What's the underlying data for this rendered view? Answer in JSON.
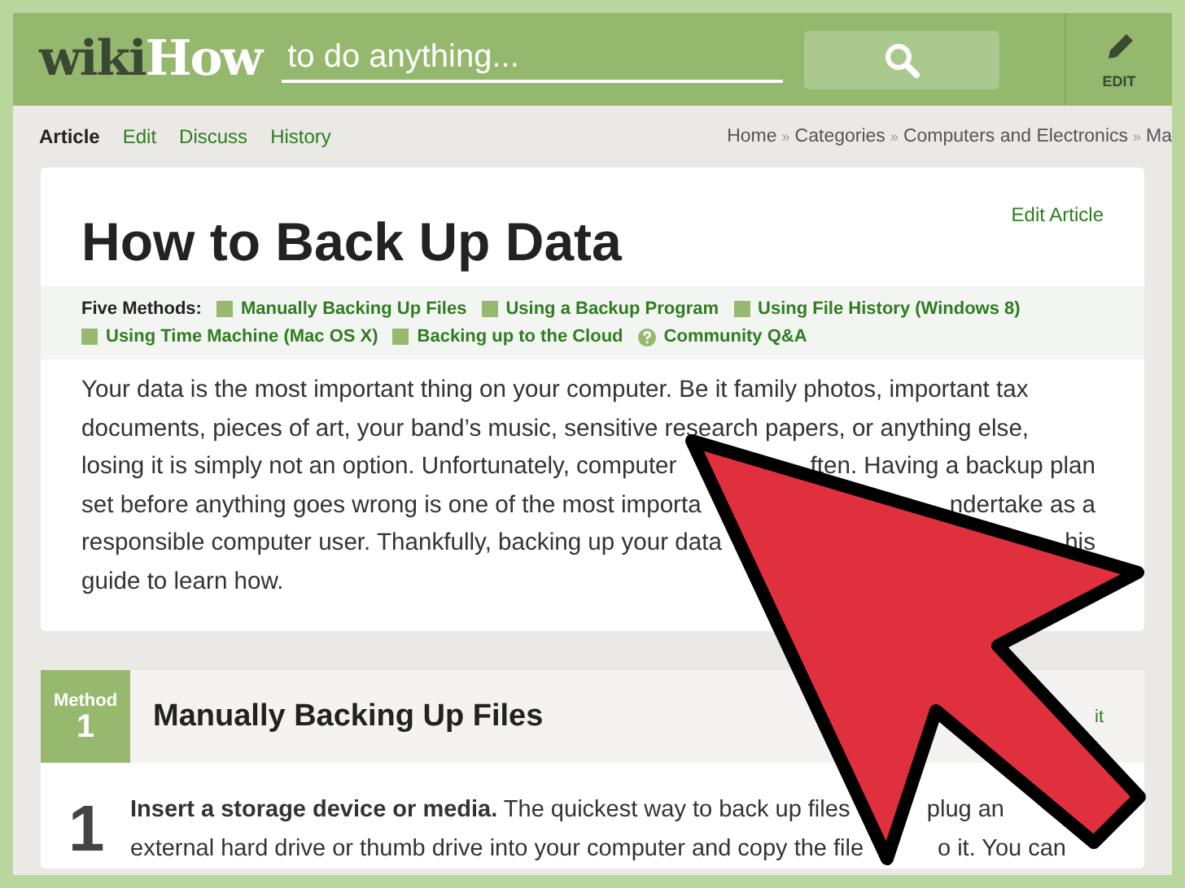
{
  "header": {
    "logo": {
      "part_1": "wiki",
      "part_2": "How"
    },
    "search": {
      "placeholder": "to do anything..."
    },
    "edit_button": "EDIT"
  },
  "tabs": [
    {
      "label": "Article",
      "selected": true
    },
    {
      "label": "Edit",
      "selected": false
    },
    {
      "label": "Discuss",
      "selected": false
    },
    {
      "label": "History",
      "selected": false
    }
  ],
  "breadcrumb": [
    "Home",
    "»",
    "Categories",
    "»",
    "Computers and Electronics",
    "»",
    "Ma"
  ],
  "article": {
    "title": "How to Back Up Data",
    "edit_link": "Edit Article",
    "methods_label": "Five Methods:",
    "methods": [
      {
        "kind": "method",
        "label": "Manually Backing Up Files"
      },
      {
        "kind": "method",
        "label": "Using a Backup Program"
      },
      {
        "kind": "method",
        "label": "Using File History (Windows 8)"
      },
      {
        "kind": "method",
        "label": "Using Time Machine (Mac OS X)"
      },
      {
        "kind": "method",
        "label": "Backing up to the Cloud"
      },
      {
        "kind": "qa",
        "label": "Community Q&A"
      }
    ],
    "intro_lines": [
      [
        "Your data is the most important thing on your computer. Be it family photos, important tax"
      ],
      [
        "documents, pieces of art, your band’s music, sensitive research papers, or anything else,"
      ],
      [
        "losing it is simply not an option. Unfortunately, computer",
        "ften. Having a backup plan"
      ],
      [
        "set before anything goes wrong is one of the most importa",
        "ndertake as a"
      ],
      [
        "responsible computer user. Thankfully, backing up your data",
        "his"
      ],
      [
        "guide to learn how."
      ]
    ]
  },
  "method": {
    "label": "Method",
    "number": "1",
    "title": "Manually Backing Up Files",
    "edit_link": "it",
    "step": {
      "number": "1",
      "lines": [
        [
          "**Insert a storage device or media.** The quickest way to back up files",
          "plug an"
        ],
        [
          "external hard drive or thumb drive into your computer and copy the file",
          "o it. You can"
        ]
      ]
    }
  }
}
